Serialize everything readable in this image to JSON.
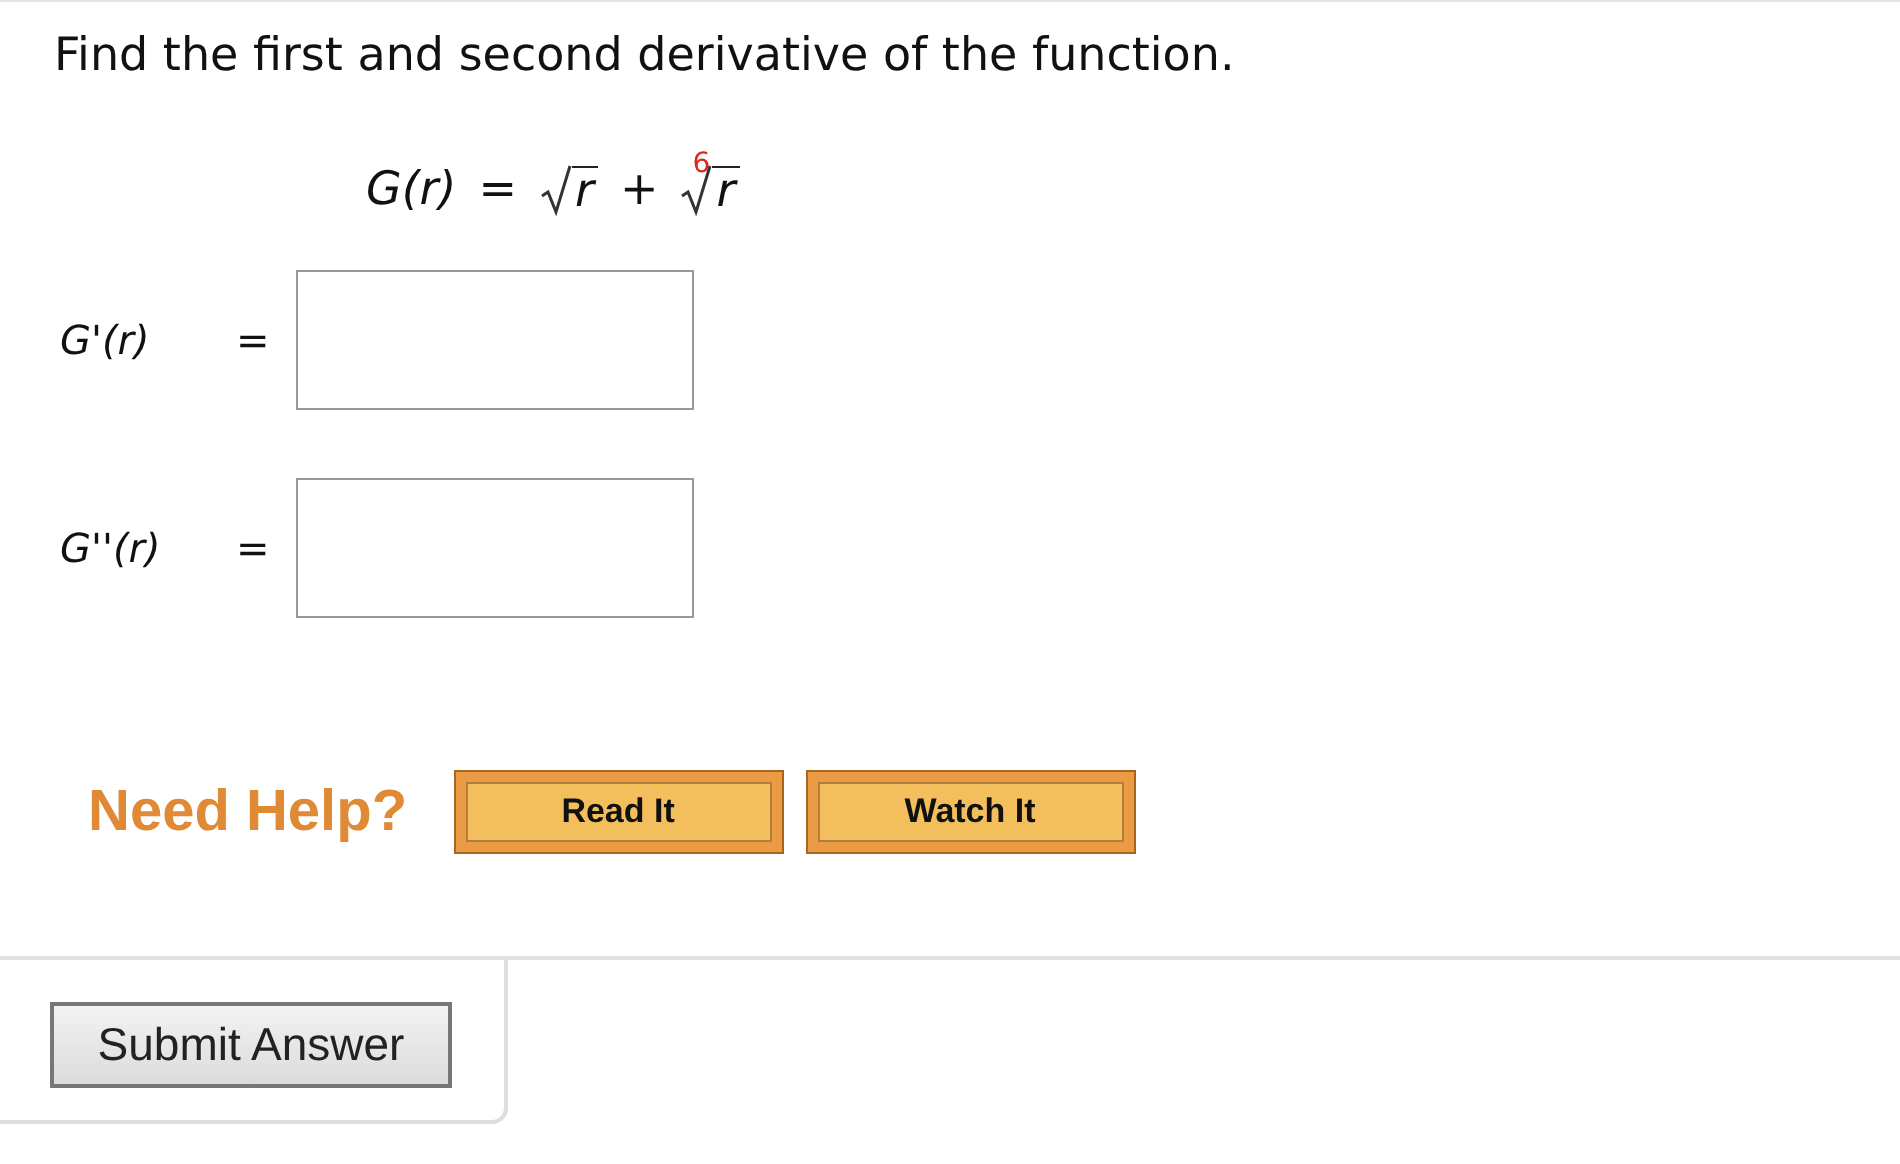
{
  "prompt": "Find the first and second derivative of the function.",
  "formula": {
    "lhs": "G(r)",
    "equals": "=",
    "terms": [
      {
        "kind": "sqrt",
        "radicand": "r"
      },
      {
        "kind": "op",
        "text": "+"
      },
      {
        "kind": "root",
        "index": "6",
        "radicand": "r"
      }
    ]
  },
  "answers": [
    {
      "label": "G'(r)",
      "equals": "="
    },
    {
      "label": "G''(r)",
      "equals": "="
    }
  ],
  "help": {
    "label": "Need Help?",
    "buttons": [
      "Read It",
      "Watch It"
    ]
  },
  "submit": "Submit Answer"
}
